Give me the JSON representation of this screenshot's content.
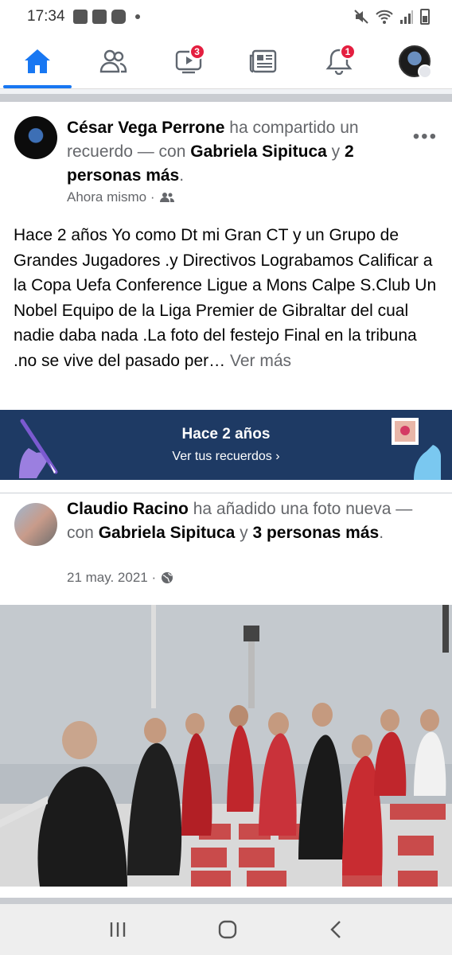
{
  "status_bar": {
    "time": "17:34",
    "left_icons": [
      "facebook-icon",
      "mail-icon",
      "youtube-icon"
    ],
    "right_icons": [
      "mute-icon",
      "wifi-icon",
      "signal-icon",
      "battery-icon"
    ]
  },
  "nav": {
    "items": [
      {
        "name": "home",
        "icon": "home-icon",
        "active": true
      },
      {
        "name": "friends",
        "icon": "friends-icon",
        "active": false
      },
      {
        "name": "watch",
        "icon": "watch-icon",
        "badge": "3"
      },
      {
        "name": "news",
        "icon": "news-icon",
        "active": false
      },
      {
        "name": "notifications",
        "icon": "bell-icon",
        "badge": "1"
      },
      {
        "name": "menu",
        "icon": "avatar-menu-icon",
        "active": false
      }
    ],
    "accent": "#1877f2",
    "badge_color": "#e41e3f"
  },
  "post": {
    "author": "César Vega Perrone",
    "action": " ha compartido un recuerdo — con ",
    "tag1": "Gabriela Sipituca",
    "connector": " y ",
    "tag2": "2 personas más",
    "tail": ".",
    "time": "Ahora mismo ·",
    "body": "Hace 2 años  Yo  como  Dt mi Gran CT y  un Grupo de Grandes Jugadores .y Directivos Lograbamos  Calificar a la Copa Uefa Conference  Ligue a Mons Calpe S.Club  Un Nobel Equipo de la Liga Premier  de Gibraltar del cual nadie  daba nada .La foto del festejo  Final en la tribuna .no se vive del pasado per…",
    "see_more": " Ver más"
  },
  "memory": {
    "title": "Hace 2 años",
    "link": "Ver tus recuerdos ›",
    "color": "#1e3a64"
  },
  "shared": {
    "author": "Claudio Racino",
    "action": " ha añadido una foto nueva — con ",
    "tag1": "Gabriela Sipituca",
    "connector": " y ",
    "tag2": "3 personas más",
    "tail": ".",
    "time": "21 may. 2021 ·"
  },
  "android_nav": [
    "recent-apps-icon",
    "home-icon",
    "back-icon"
  ]
}
